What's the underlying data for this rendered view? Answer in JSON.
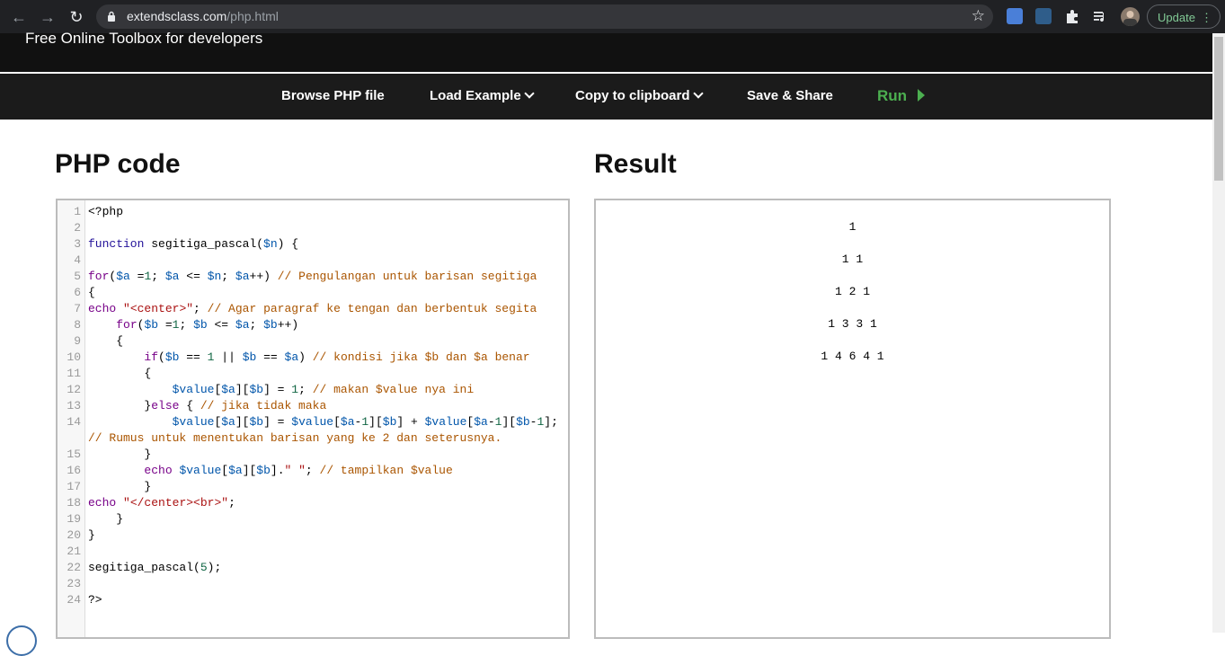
{
  "browser": {
    "url_host": "extendsclass.com",
    "url_path": "/php.html",
    "update_label": "Update",
    "icons": [
      "back-arrow-icon",
      "forward-arrow-icon",
      "reload-icon",
      "lock-icon",
      "star-icon",
      "translate-icon",
      "extension-icon",
      "puzzle-icon",
      "reading-list-icon",
      "menu-dots-icon"
    ]
  },
  "site": {
    "tagline": "Free Online Toolbox for developers"
  },
  "toolbar": {
    "browse": "Browse PHP file",
    "load_example": "Load Example",
    "copy": "Copy to clipboard",
    "save_share": "Save & Share",
    "run": "Run"
  },
  "editor": {
    "heading": "PHP code",
    "lines": [
      {
        "n": "1",
        "t": "<?php"
      },
      {
        "n": "2",
        "t": ""
      },
      {
        "n": "3",
        "t": "function segitiga_pascal($n) {"
      },
      {
        "n": "4",
        "t": ""
      },
      {
        "n": "5",
        "t": "for($a =1; $a <= $n; $a++) // Pengulangan untuk barisan segitiga"
      },
      {
        "n": "6",
        "t": "{"
      },
      {
        "n": "7",
        "t": "echo \"<center>\"; // Agar paragraf ke tengan dan berbentuk segita"
      },
      {
        "n": "8",
        "t": "    for($b =1; $b <= $a; $b++)"
      },
      {
        "n": "9",
        "t": "    {"
      },
      {
        "n": "10",
        "t": "        if($b == 1 || $b == $a) // kondisi jika $b dan $a benar"
      },
      {
        "n": "11",
        "t": "        {"
      },
      {
        "n": "12",
        "t": "            $value[$a][$b] = 1; // makan $value nya ini"
      },
      {
        "n": "13",
        "t": "        }else { // jika tidak maka"
      },
      {
        "n": "14",
        "t": "            $value[$a][$b] = $value[$a-1][$b] + $value[$a-1][$b-1];"
      },
      {
        "n": "",
        "t": "// Rumus untuk menentukan barisan yang ke 2 dan seterusnya."
      },
      {
        "n": "15",
        "t": "        }"
      },
      {
        "n": "16",
        "t": "        echo $value[$a][$b].\" \"; // tampilkan $value"
      },
      {
        "n": "17",
        "t": "        }"
      },
      {
        "n": "18",
        "t": "echo \"</center><br>\";"
      },
      {
        "n": "19",
        "t": "    }"
      },
      {
        "n": "20",
        "t": "}"
      },
      {
        "n": "21",
        "t": ""
      },
      {
        "n": "22",
        "t": "segitiga_pascal(5);"
      },
      {
        "n": "23",
        "t": ""
      },
      {
        "n": "24",
        "t": "?>"
      }
    ]
  },
  "result": {
    "heading": "Result",
    "lines": [
      "1",
      "1 1",
      "1 2 1",
      "1 3 3 1",
      "1 4 6 4 1"
    ]
  },
  "colors": {
    "run_green": "#4caf50",
    "toolbar_bg": "#1b1b1b",
    "chrome_bg": "#202124"
  }
}
